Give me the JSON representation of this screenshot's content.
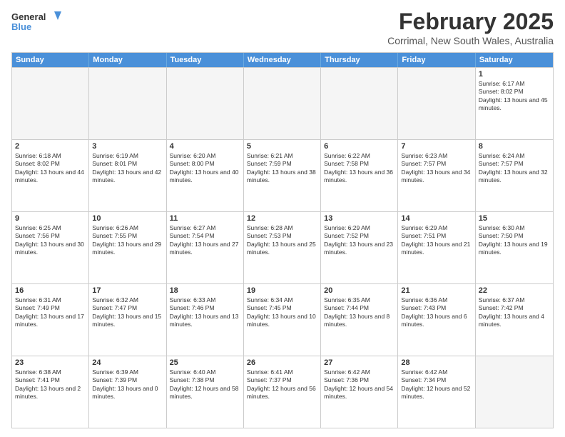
{
  "logo": {
    "line1": "General",
    "line2": "Blue"
  },
  "title": "February 2025",
  "location": "Corrimal, New South Wales, Australia",
  "days": [
    "Sunday",
    "Monday",
    "Tuesday",
    "Wednesday",
    "Thursday",
    "Friday",
    "Saturday"
  ],
  "rows": [
    [
      {
        "day": "",
        "empty": true
      },
      {
        "day": "",
        "empty": true
      },
      {
        "day": "",
        "empty": true
      },
      {
        "day": "",
        "empty": true
      },
      {
        "day": "",
        "empty": true
      },
      {
        "day": "",
        "empty": true
      },
      {
        "day": "1",
        "sunrise": "Sunrise: 6:17 AM",
        "sunset": "Sunset: 8:02 PM",
        "daylight": "Daylight: 13 hours and 45 minutes."
      }
    ],
    [
      {
        "day": "2",
        "sunrise": "Sunrise: 6:18 AM",
        "sunset": "Sunset: 8:02 PM",
        "daylight": "Daylight: 13 hours and 44 minutes."
      },
      {
        "day": "3",
        "sunrise": "Sunrise: 6:19 AM",
        "sunset": "Sunset: 8:01 PM",
        "daylight": "Daylight: 13 hours and 42 minutes."
      },
      {
        "day": "4",
        "sunrise": "Sunrise: 6:20 AM",
        "sunset": "Sunset: 8:00 PM",
        "daylight": "Daylight: 13 hours and 40 minutes."
      },
      {
        "day": "5",
        "sunrise": "Sunrise: 6:21 AM",
        "sunset": "Sunset: 7:59 PM",
        "daylight": "Daylight: 13 hours and 38 minutes."
      },
      {
        "day": "6",
        "sunrise": "Sunrise: 6:22 AM",
        "sunset": "Sunset: 7:58 PM",
        "daylight": "Daylight: 13 hours and 36 minutes."
      },
      {
        "day": "7",
        "sunrise": "Sunrise: 6:23 AM",
        "sunset": "Sunset: 7:57 PM",
        "daylight": "Daylight: 13 hours and 34 minutes."
      },
      {
        "day": "8",
        "sunrise": "Sunrise: 6:24 AM",
        "sunset": "Sunset: 7:57 PM",
        "daylight": "Daylight: 13 hours and 32 minutes."
      }
    ],
    [
      {
        "day": "9",
        "sunrise": "Sunrise: 6:25 AM",
        "sunset": "Sunset: 7:56 PM",
        "daylight": "Daylight: 13 hours and 30 minutes."
      },
      {
        "day": "10",
        "sunrise": "Sunrise: 6:26 AM",
        "sunset": "Sunset: 7:55 PM",
        "daylight": "Daylight: 13 hours and 29 minutes."
      },
      {
        "day": "11",
        "sunrise": "Sunrise: 6:27 AM",
        "sunset": "Sunset: 7:54 PM",
        "daylight": "Daylight: 13 hours and 27 minutes."
      },
      {
        "day": "12",
        "sunrise": "Sunrise: 6:28 AM",
        "sunset": "Sunset: 7:53 PM",
        "daylight": "Daylight: 13 hours and 25 minutes."
      },
      {
        "day": "13",
        "sunrise": "Sunrise: 6:29 AM",
        "sunset": "Sunset: 7:52 PM",
        "daylight": "Daylight: 13 hours and 23 minutes."
      },
      {
        "day": "14",
        "sunrise": "Sunrise: 6:29 AM",
        "sunset": "Sunset: 7:51 PM",
        "daylight": "Daylight: 13 hours and 21 minutes."
      },
      {
        "day": "15",
        "sunrise": "Sunrise: 6:30 AM",
        "sunset": "Sunset: 7:50 PM",
        "daylight": "Daylight: 13 hours and 19 minutes."
      }
    ],
    [
      {
        "day": "16",
        "sunrise": "Sunrise: 6:31 AM",
        "sunset": "Sunset: 7:49 PM",
        "daylight": "Daylight: 13 hours and 17 minutes."
      },
      {
        "day": "17",
        "sunrise": "Sunrise: 6:32 AM",
        "sunset": "Sunset: 7:47 PM",
        "daylight": "Daylight: 13 hours and 15 minutes."
      },
      {
        "day": "18",
        "sunrise": "Sunrise: 6:33 AM",
        "sunset": "Sunset: 7:46 PM",
        "daylight": "Daylight: 13 hours and 13 minutes."
      },
      {
        "day": "19",
        "sunrise": "Sunrise: 6:34 AM",
        "sunset": "Sunset: 7:45 PM",
        "daylight": "Daylight: 13 hours and 10 minutes."
      },
      {
        "day": "20",
        "sunrise": "Sunrise: 6:35 AM",
        "sunset": "Sunset: 7:44 PM",
        "daylight": "Daylight: 13 hours and 8 minutes."
      },
      {
        "day": "21",
        "sunrise": "Sunrise: 6:36 AM",
        "sunset": "Sunset: 7:43 PM",
        "daylight": "Daylight: 13 hours and 6 minutes."
      },
      {
        "day": "22",
        "sunrise": "Sunrise: 6:37 AM",
        "sunset": "Sunset: 7:42 PM",
        "daylight": "Daylight: 13 hours and 4 minutes."
      }
    ],
    [
      {
        "day": "23",
        "sunrise": "Sunrise: 6:38 AM",
        "sunset": "Sunset: 7:41 PM",
        "daylight": "Daylight: 13 hours and 2 minutes."
      },
      {
        "day": "24",
        "sunrise": "Sunrise: 6:39 AM",
        "sunset": "Sunset: 7:39 PM",
        "daylight": "Daylight: 13 hours and 0 minutes."
      },
      {
        "day": "25",
        "sunrise": "Sunrise: 6:40 AM",
        "sunset": "Sunset: 7:38 PM",
        "daylight": "Daylight: 12 hours and 58 minutes."
      },
      {
        "day": "26",
        "sunrise": "Sunrise: 6:41 AM",
        "sunset": "Sunset: 7:37 PM",
        "daylight": "Daylight: 12 hours and 56 minutes."
      },
      {
        "day": "27",
        "sunrise": "Sunrise: 6:42 AM",
        "sunset": "Sunset: 7:36 PM",
        "daylight": "Daylight: 12 hours and 54 minutes."
      },
      {
        "day": "28",
        "sunrise": "Sunrise: 6:42 AM",
        "sunset": "Sunset: 7:34 PM",
        "daylight": "Daylight: 12 hours and 52 minutes."
      },
      {
        "day": "",
        "empty": true
      }
    ]
  ]
}
